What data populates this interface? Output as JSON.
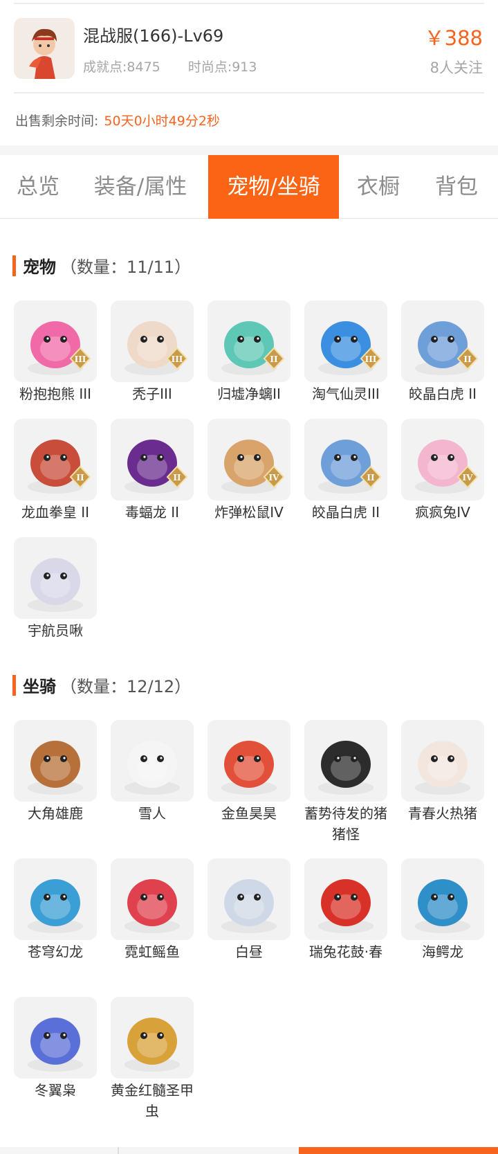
{
  "account": {
    "server_title": "混战服(166)-Lv69",
    "achievement_points": "成就点:8475",
    "fashion_points": "时尚点:913",
    "price": "￥388",
    "followers": "8人关注"
  },
  "sale": {
    "remaining_label": "出售剩余时间:",
    "remaining_value": "50天0小时49分2秒"
  },
  "tabs": [
    {
      "label": "总览",
      "active": false
    },
    {
      "label": "装备/属性",
      "active": false
    },
    {
      "label": "宠物/坐骑",
      "active": true
    },
    {
      "label": "衣橱",
      "active": false
    },
    {
      "label": "背包",
      "active": false
    }
  ],
  "pets": {
    "title": "宠物",
    "count": "（数量：11/11）",
    "items": [
      {
        "name": "粉抱抱熊 III",
        "icon": "pink-bear-pet-icon",
        "rank": "III",
        "color": "#f06aa8"
      },
      {
        "name": "秃子III",
        "icon": "bald-kid-pet-icon",
        "rank": "III",
        "color": "#efd9c9"
      },
      {
        "name": "归墟净螭II",
        "icon": "jade-dragon-pet-icon",
        "rank": "II",
        "color": "#5fc7b5"
      },
      {
        "name": "淘气仙灵III",
        "icon": "blue-puppy-pet-icon",
        "rank": "III",
        "color": "#3a8fe0"
      },
      {
        "name": "皎晶白虎 II",
        "icon": "white-tiger-pet-icon",
        "rank": "II",
        "color": "#6f9fd8"
      },
      {
        "name": "龙血拳皇 II",
        "icon": "red-beast-pet-icon",
        "rank": "II",
        "color": "#c84d3a"
      },
      {
        "name": "毒蝠龙 II",
        "icon": "poison-bat-dragon-pet-icon",
        "rank": "II",
        "color": "#6a2d8f"
      },
      {
        "name": "炸弹松鼠IV",
        "icon": "bomb-squirrel-pet-icon",
        "rank": "IV",
        "color": "#d9a46b"
      },
      {
        "name": "皎晶白虎 II",
        "icon": "white-tiger-pet-icon",
        "rank": "II",
        "color": "#6f9fd8"
      },
      {
        "name": "疯疯兔IV",
        "icon": "crazy-rabbit-pet-icon",
        "rank": "IV",
        "color": "#f4b6cf"
      },
      {
        "name": "宇航员啾",
        "icon": "astronaut-pet-icon",
        "rank": "",
        "color": "#d8d8e8"
      }
    ]
  },
  "mounts": {
    "title": "坐骑",
    "count": "（数量：12/12）",
    "items": [
      {
        "name": "大角雄鹿",
        "icon": "stag-mount-icon",
        "color": "#b8703a"
      },
      {
        "name": "雪人",
        "icon": "snowman-mount-icon",
        "color": "#f5f5f5"
      },
      {
        "name": "金鱼昊昊",
        "icon": "goldfish-mount-icon",
        "color": "#e2503a"
      },
      {
        "name": "蓄势待发的猪猪怪",
        "icon": "black-pig-mount-icon",
        "color": "#2c2c2c"
      },
      {
        "name": "青春火热猪",
        "icon": "white-pig-mount-icon",
        "color": "#f2e6df"
      },
      {
        "name": "苍穹幻龙",
        "icon": "sky-dragon-mount-icon",
        "color": "#3b9fd6"
      },
      {
        "name": "霓虹鳐鱼",
        "icon": "neon-ray-mount-icon",
        "color": "#e0414e"
      },
      {
        "name": "白昼",
        "icon": "white-dragon-mount-icon",
        "color": "#cfd8e6"
      },
      {
        "name": "瑞兔花鼓·春",
        "icon": "rabbit-drum-mount-icon",
        "color": "#d83228"
      },
      {
        "name": "海鳄龙",
        "icon": "sea-crocodile-dragon-mount-icon",
        "color": "#2f8fc8"
      },
      {
        "name": "冬翼枭",
        "icon": "winter-owl-mount-icon",
        "color": "#5a6fd8"
      },
      {
        "name": "黄金红髓圣甲虫",
        "icon": "golden-scarab-mount-icon",
        "color": "#d9a13a"
      }
    ]
  }
}
